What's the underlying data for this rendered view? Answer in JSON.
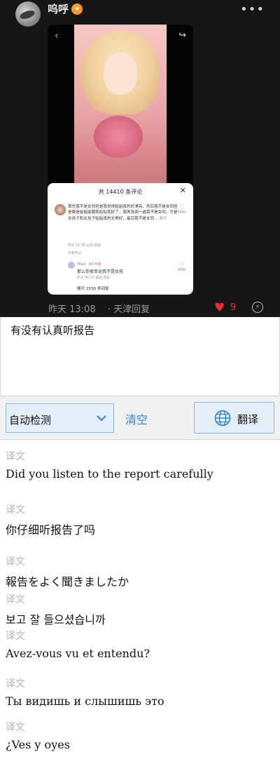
{
  "post": {
    "username": "呜呼",
    "more_label": "•••",
    "time": "昨天 13:08",
    "location": "· 天津",
    "reply": "回复",
    "like_count": "9",
    "embedded": {
      "comments_title": "共 14410 条评论",
      "comment_text": "首先我不是女同但是我觉得姐姐真的好漂亮，然后我不是女同但是要是姐姐能跟我贴贴就好了，我再强调一遍我不是女同，可是女孩子和女孩子贴贴真的太美好，最后我不是女同...",
      "comment_expand": "展开",
      "comment_meta": "昨天 01:36 山西 回复",
      "comment_tag": "作者赞过",
      "comment_likes": "5691",
      "reply_name": "Mika！Ad",
      "reply_badge": "作者",
      "reply_text": "那么你很幸运我不是女孩",
      "reply_meta": "昨天 01:43 美国 回复",
      "reply_likes": "8692",
      "expand_replies": "展开 2550 条回复"
    }
  },
  "translator": {
    "input_text": "有没有认真听报告",
    "language": "自动检测",
    "clear_label": "清空",
    "translate_label": "翻译",
    "result_label": "译文",
    "results": [
      "Did you listen to the report carefully",
      "你仔细听报告了吗",
      "報告をよく聞きましたか",
      "보고 잘 들으셨습니까",
      "Avez-vous vu et entendu?",
      "Ты видишь и слышишь это",
      "¿Ves y oyes"
    ]
  }
}
